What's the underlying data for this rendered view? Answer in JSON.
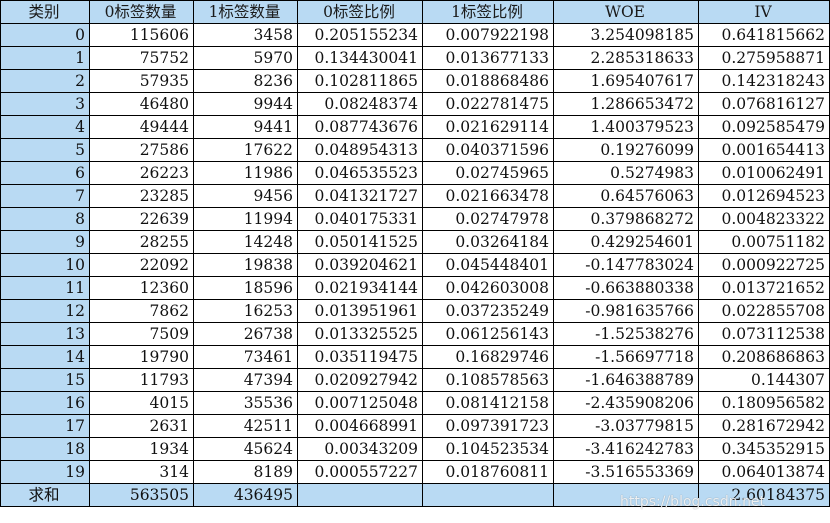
{
  "headers": [
    "类别",
    "0标签数量",
    "1标签数量",
    "0标签比例",
    "1标签比例",
    "WOE",
    "IV"
  ],
  "rows": [
    [
      "0",
      "115606",
      "3458",
      "0.205155234",
      "0.007922198",
      "3.254098185",
      "0.641815662"
    ],
    [
      "1",
      "75752",
      "5970",
      "0.134430041",
      "0.013677133",
      "2.285318633",
      "0.275958871"
    ],
    [
      "2",
      "57935",
      "8236",
      "0.102811865",
      "0.018868486",
      "1.695407617",
      "0.142318243"
    ],
    [
      "3",
      "46480",
      "9944",
      "0.08248374",
      "0.022781475",
      "1.286653472",
      "0.076816127"
    ],
    [
      "4",
      "49444",
      "9441",
      "0.087743676",
      "0.021629114",
      "1.400379523",
      "0.092585479"
    ],
    [
      "5",
      "27586",
      "17622",
      "0.048954313",
      "0.040371596",
      "0.19276099",
      "0.001654413"
    ],
    [
      "6",
      "26223",
      "11986",
      "0.046535523",
      "0.02745965",
      "0.5274983",
      "0.010062491"
    ],
    [
      "7",
      "23285",
      "9456",
      "0.041321727",
      "0.021663478",
      "0.64576063",
      "0.012694523"
    ],
    [
      "8",
      "22639",
      "11994",
      "0.040175331",
      "0.02747978",
      "0.379868272",
      "0.004823322"
    ],
    [
      "9",
      "28255",
      "14248",
      "0.050141525",
      "0.03264184",
      "0.429254601",
      "0.00751182"
    ],
    [
      "10",
      "22092",
      "19838",
      "0.039204621",
      "0.045448401",
      "-0.147783024",
      "0.000922725"
    ],
    [
      "11",
      "12360",
      "18596",
      "0.021934144",
      "0.042603008",
      "-0.663880338",
      "0.013721652"
    ],
    [
      "12",
      "7862",
      "16253",
      "0.013951961",
      "0.037235249",
      "-0.981635766",
      "0.022855708"
    ],
    [
      "13",
      "7509",
      "26738",
      "0.013325525",
      "0.061256143",
      "-1.52538276",
      "0.073112538"
    ],
    [
      "14",
      "19790",
      "73461",
      "0.035119475",
      "0.16829746",
      "-1.56697718",
      "0.208686863"
    ],
    [
      "15",
      "11793",
      "47394",
      "0.020927942",
      "0.108578563",
      "-1.646388789",
      "0.144307"
    ],
    [
      "16",
      "4015",
      "35536",
      "0.007125048",
      "0.081412158",
      "-2.435908206",
      "0.180956582"
    ],
    [
      "17",
      "2631",
      "42511",
      "0.004668991",
      "0.097391723",
      "-3.03779815",
      "0.281672942"
    ],
    [
      "18",
      "1934",
      "45624",
      "0.00343209",
      "0.104523534",
      "-3.416242783",
      "0.345352915"
    ],
    [
      "19",
      "314",
      "8189",
      "0.000557227",
      "0.018760811",
      "-3.516553369",
      "0.064013874"
    ]
  ],
  "total": {
    "label": "求和",
    "count0": "563505",
    "count1": "436495",
    "iv": "2.60184375"
  },
  "watermark": "https://blog.csdn.net",
  "colors": {
    "header_bg": "#b9daf3",
    "grid": "#000000"
  }
}
